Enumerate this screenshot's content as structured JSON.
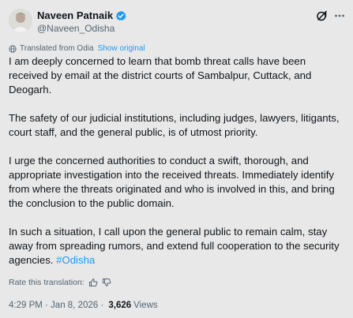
{
  "author": {
    "name": "Naveen Patnaik",
    "handle": "@Naveen_Odisha"
  },
  "translation": {
    "label": "Translated from Odia",
    "show_original": "Show original"
  },
  "post": {
    "paragraphs": [
      "I am deeply concerned to learn that bomb threat calls have been received by email at the district courts of Sambalpur, Cuttack, and Deogarh.",
      "The safety of our judicial institutions, including judges, lawyers, litigants, court staff, and the general public, is of utmost priority.",
      "I urge the concerned authorities to conduct a swift, thorough, and appropriate investigation into the received threats. Immediately identify from where the threats originated and who is involved in this, and bring the conclusion to the public domain.",
      "In such a situation, I call upon the general public to remain calm, stay away from spreading rumors, and extend full cooperation to the security agencies."
    ],
    "hashtag": "#Odisha"
  },
  "rating": {
    "label": "Rate this translation:"
  },
  "meta": {
    "timestamp": "4:29 PM · Jan 8, 2026 · ",
    "views_count": "3,626",
    "views_label": "Views"
  },
  "icons": {
    "verified": "verified-badge-icon",
    "grok": "grok-icon",
    "more": "more-icon",
    "translate": "globe-icon",
    "thumbs_up": "thumbs-up-icon",
    "thumbs_down": "thumbs-down-icon"
  },
  "colors": {
    "accent": "#1d9bf0",
    "background": "#e8e8e8",
    "secondary_text": "#536471"
  }
}
